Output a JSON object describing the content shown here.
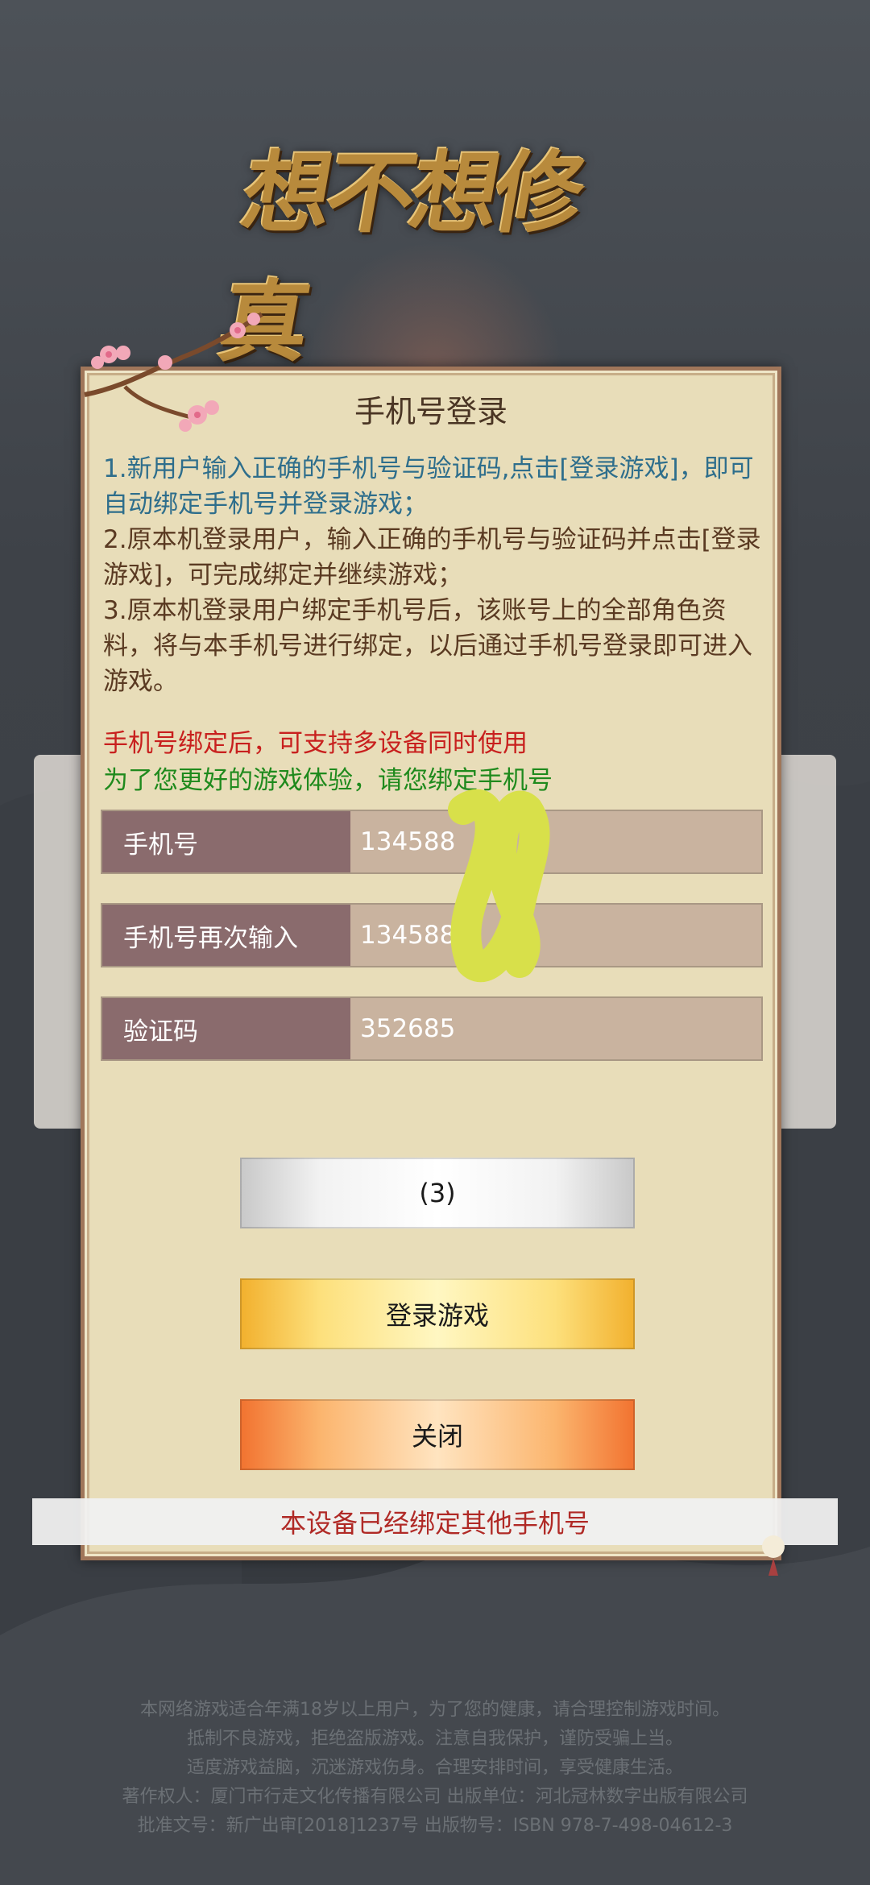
{
  "logo": {
    "text": "想不想修真"
  },
  "dialog": {
    "title": "手机号登录",
    "notice": {
      "item1": "1.新用户输入正确的手机号与验证码,点击[登录游戏]，即可自动绑定手机号并登录游戏；",
      "item2": "2.原本机登录用户，输入正确的手机号与验证码并点击[登录游戏]，可完成绑定并继续游戏；",
      "item3": "3.原本机登录用户绑定手机号后，该账号上的全部角色资料，将与本手机号进行绑定，以后通过手机号登录即可进入游戏。"
    },
    "red_line": "手机号绑定后，可支持多设备同时使用",
    "green_line": "为了您更好的游戏体验，请您绑定手机号",
    "fields": {
      "phone": {
        "label": "手机号",
        "value": "134588"
      },
      "phone_repeat": {
        "label": "手机号再次输入",
        "value": "134588"
      },
      "code": {
        "label": "验证码",
        "value": "352685"
      }
    },
    "buttons": {
      "countdown": "(3)",
      "login": "登录游戏",
      "close": "关闭"
    }
  },
  "toast": "本设备已经绑定其他手机号",
  "footer": {
    "line1": "本网络游戏适合年满18岁以上用户，为了您的健康，请合理控制游戏时间。",
    "line2": "抵制不良游戏，拒绝盗版游戏。注意自我保护，谨防受骗上当。",
    "line3": "适度游戏益脑，沉迷游戏伤身。合理安排时间，享受健康生活。",
    "line4": "著作权人：厦门市行走文化传播有限公司  出版单位：河北冠林数字出版有限公司",
    "line5": "批准文号：新广出审[2018]1237号  出版物号：ISBN 978-7-498-04612-3"
  },
  "colors": {
    "dialog_bg": "#e8ddb9",
    "label_bg": "#8a6b6d",
    "value_bg": "#c9b39f",
    "notice_blue": "#2e6e8c",
    "warning_red": "#c8201e",
    "hint_green": "#1f8a1d"
  }
}
